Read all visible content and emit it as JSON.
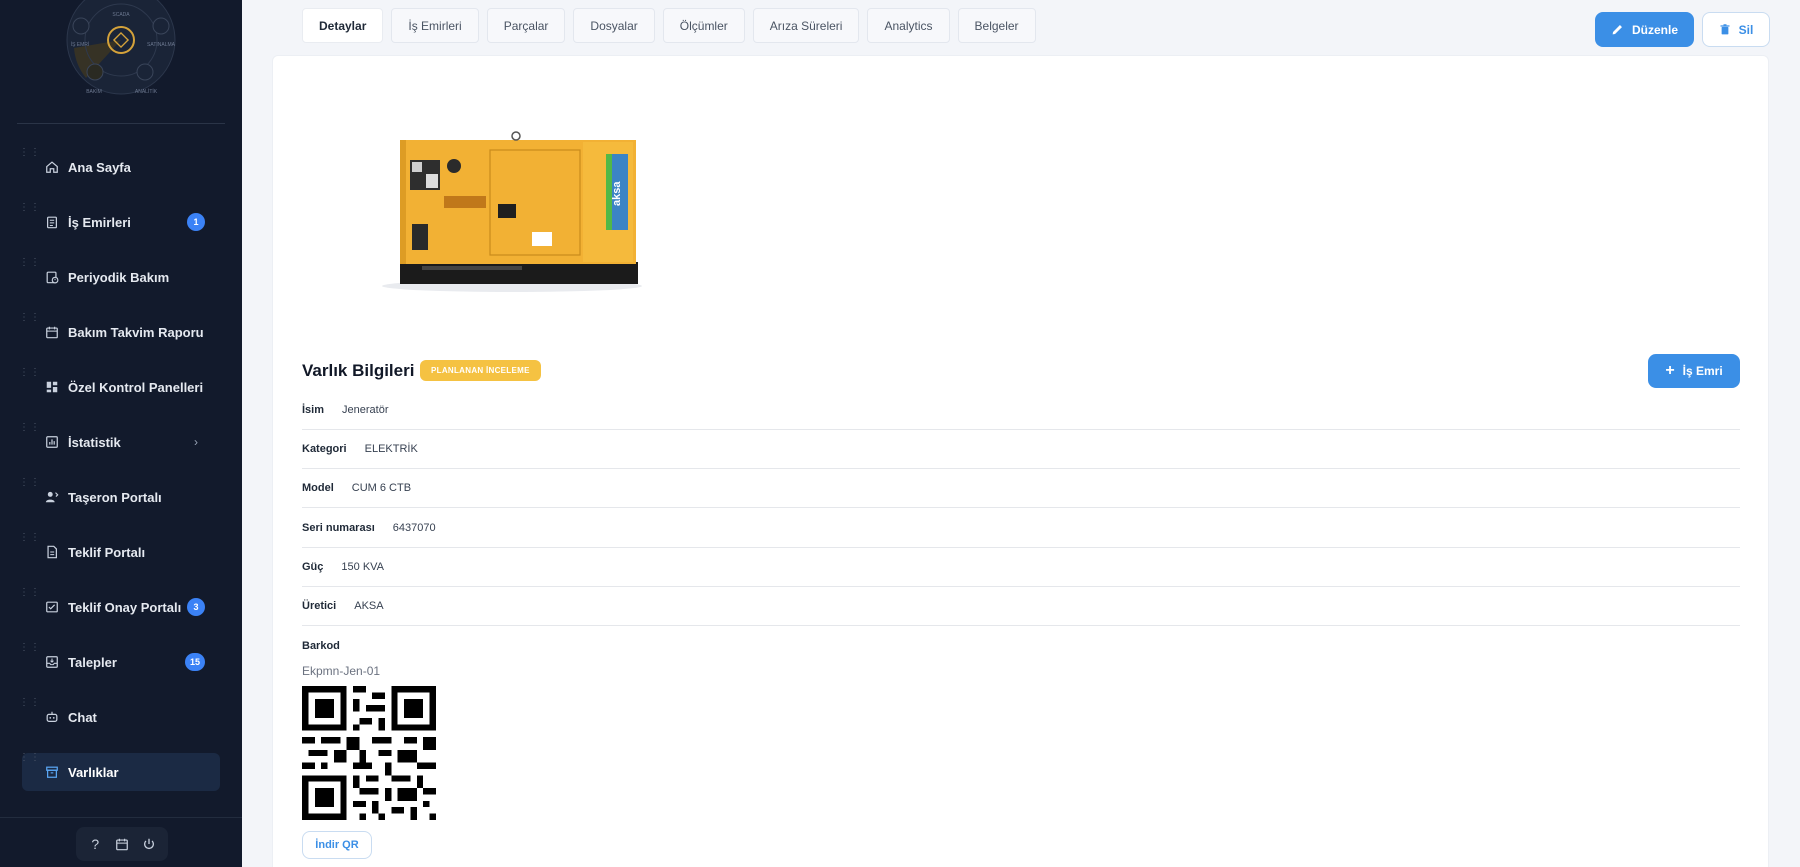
{
  "sidebar": {
    "logo_labels": [
      "SCADA",
      "İŞ EMRİ",
      "SATINALMA",
      "BAKIM",
      "ANALİTİK"
    ],
    "items": [
      {
        "label": "Ana Sayfa",
        "icon": "home-icon"
      },
      {
        "label": "İş Emirleri",
        "icon": "clipboard-icon",
        "badge": "1"
      },
      {
        "label": "Periyodik Bakım",
        "icon": "clipboard-clock-icon"
      },
      {
        "label": "Bakım Takvim Raporu",
        "icon": "calendar-icon"
      },
      {
        "label": "Özel Kontrol Panelleri",
        "icon": "dashboard-icon"
      },
      {
        "label": "İstatistik",
        "icon": "bar-chart-icon",
        "chevron": "›"
      },
      {
        "label": "Taşeron Portalı",
        "icon": "contractor-icon"
      },
      {
        "label": "Teklif Portalı",
        "icon": "document-icon"
      },
      {
        "label": "Teklif Onay Portalı",
        "icon": "approval-icon",
        "badge": "3"
      },
      {
        "label": "Talepler",
        "icon": "inbox-icon",
        "badge": "15"
      },
      {
        "label": "Chat",
        "icon": "chat-bot-icon"
      },
      {
        "label": "Varlıklar",
        "icon": "archive-icon",
        "active": true
      }
    ],
    "footer": {
      "help": "?",
      "calendar": "calendar-icon",
      "power": "power-icon"
    }
  },
  "tabs": [
    {
      "label": "Detaylar",
      "active": true
    },
    {
      "label": "İş Emirleri"
    },
    {
      "label": "Parçalar"
    },
    {
      "label": "Dosyalar"
    },
    {
      "label": "Ölçümler"
    },
    {
      "label": "Arıza Süreleri"
    },
    {
      "label": "Analytics"
    },
    {
      "label": "Belgeler"
    }
  ],
  "actions": {
    "edit_label": "Düzenle",
    "delete_label": "Sil"
  },
  "asset": {
    "section_title": "Varlık Bilgileri",
    "status": "PLANLANAN İNCELEME",
    "work_order_label": "İş Emri",
    "image_brand": "aksa",
    "fields": [
      {
        "label": "İsim",
        "value": "Jeneratör"
      },
      {
        "label": "Kategori",
        "value": "ELEKTRİK"
      },
      {
        "label": "Model",
        "value": "CUM 6 CTB"
      },
      {
        "label": "Seri numarası",
        "value": "6437070"
      },
      {
        "label": "Güç",
        "value": "150 KVA"
      },
      {
        "label": "Üretici",
        "value": "AKSA"
      }
    ],
    "barcode_label": "Barkod",
    "barcode_value": "Ekpmn-Jen-01",
    "download_qr_label": "İndir QR"
  },
  "colors": {
    "sidebar_bg": "#121a2c",
    "accent": "#3b8fe6",
    "badge": "#3b82f6",
    "status_badge": "#f5c242"
  }
}
